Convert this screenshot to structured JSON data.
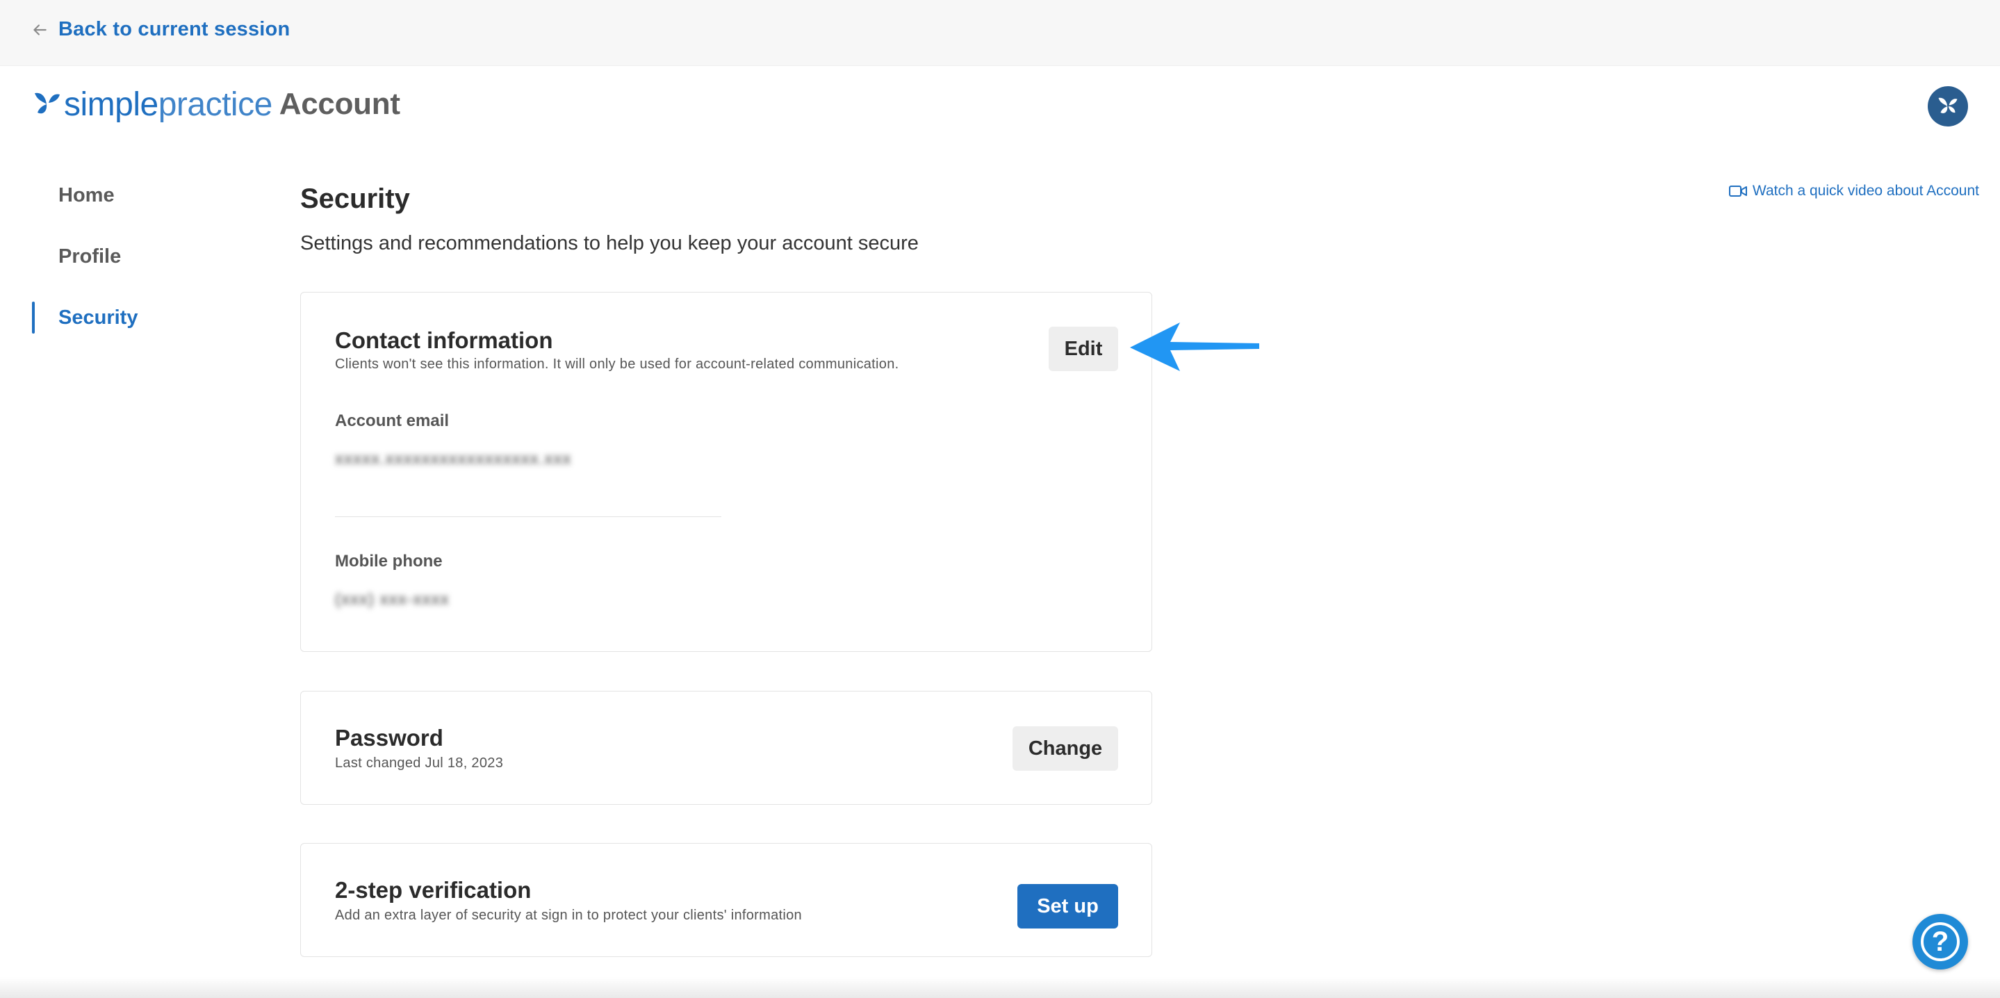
{
  "topbar": {
    "back_label": "Back to current session"
  },
  "brand": {
    "simple": "simple",
    "practice": "practice",
    "account": "Account",
    "accent": "#1f6fc0"
  },
  "sidebar": {
    "items": [
      {
        "label": "Home",
        "active": false
      },
      {
        "label": "Profile",
        "active": false
      },
      {
        "label": "Security",
        "active": true
      }
    ]
  },
  "header": {
    "video_link": "Watch a quick video about Account"
  },
  "page": {
    "title": "Security",
    "subtitle": "Settings and recommendations to help you keep your account secure"
  },
  "contact": {
    "title": "Contact information",
    "description": "Clients won't see this information. It will only be used for account-related communication.",
    "edit_label": "Edit",
    "email_label": "Account email",
    "email_value": "xxxxx.xxxxxxxxxxxxxxxxx.xxx",
    "phone_label": "Mobile phone",
    "phone_value": "(xxx) xxx-xxxx"
  },
  "password": {
    "title": "Password",
    "description": "Last changed Jul 18, 2023",
    "change_label": "Change"
  },
  "two_step": {
    "title": "2-step verification",
    "description": "Add an extra layer of security at sign in to protect your clients' information",
    "setup_label": "Set up"
  },
  "help": {
    "label": "?"
  },
  "icons": [
    "arrow-left-icon",
    "butterfly-logo-icon",
    "video-camera-icon",
    "help-icon",
    "annotation-arrow-icon"
  ]
}
